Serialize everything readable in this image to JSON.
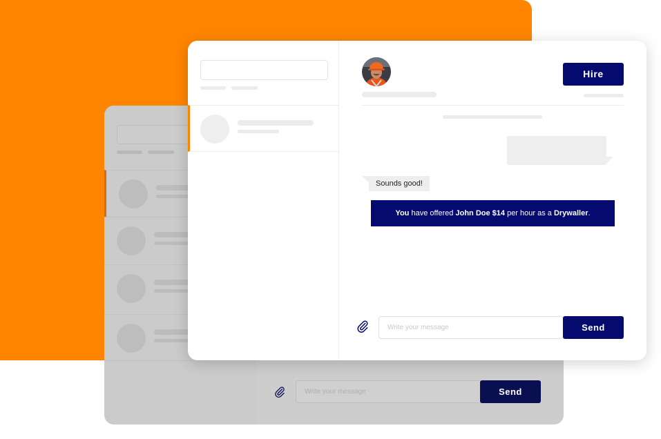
{
  "colors": {
    "accent": "#ff8500",
    "primary": "#050a6e",
    "background": "#ffffff"
  },
  "back_window": {
    "input_placeholder": "Write your message",
    "send_label": "Send",
    "attach_icon": "paperclip-icon"
  },
  "chat": {
    "hire_label": "Hire",
    "incoming_message": "Sounds good!",
    "offer": {
      "subject": "You",
      "text1": " have offered ",
      "name_rate": "John Doe $14",
      "text2": " per hour as a ",
      "role": "Drywaller",
      "text3": "."
    },
    "input_placeholder": "Write your message",
    "send_label": "Send",
    "attach_icon": "paperclip-icon",
    "avatar_icon": "worker-avatar"
  }
}
